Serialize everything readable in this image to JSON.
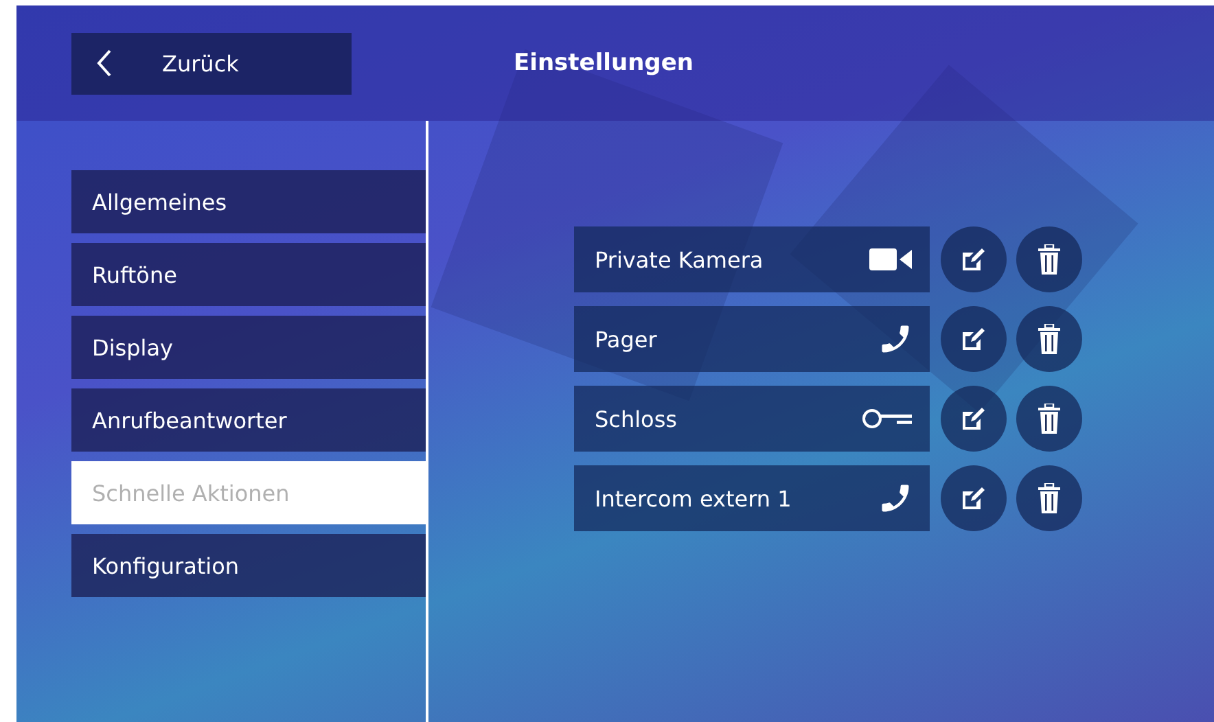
{
  "header": {
    "back_label": "Zurück",
    "title": "Einstellungen"
  },
  "sidebar": {
    "items": [
      {
        "label": "Allgemeines",
        "selected": false
      },
      {
        "label": "Ruftöne",
        "selected": false
      },
      {
        "label": "Display",
        "selected": false
      },
      {
        "label": "Anrufbeantworter",
        "selected": false
      },
      {
        "label": "Schnelle Aktionen",
        "selected": true
      },
      {
        "label": "Konfiguration",
        "selected": false
      }
    ]
  },
  "actions": [
    {
      "label": "Private Kamera",
      "kind": "camera"
    },
    {
      "label": "Pager",
      "kind": "phone"
    },
    {
      "label": "Schloss",
      "kind": "key"
    },
    {
      "label": "Intercom extern 1",
      "kind": "phone"
    }
  ]
}
